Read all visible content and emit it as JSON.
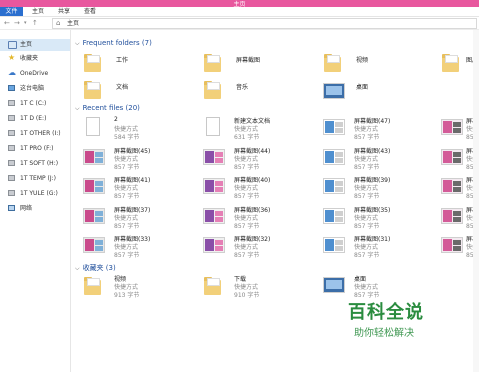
{
  "window": {
    "title": "主页"
  },
  "ribbon": {
    "file": "文件",
    "tabs": [
      "主页",
      "共享",
      "查看"
    ]
  },
  "address": {
    "path": "主页"
  },
  "sidebar": {
    "items": [
      {
        "label": "主页",
        "icon": "home-icon"
      },
      {
        "label": "收藏夹",
        "icon": "star-icon"
      },
      {
        "label": "OneDrive",
        "icon": "cloud-icon"
      },
      {
        "label": "这台电脑",
        "icon": "computer-icon"
      },
      {
        "label": "1T C (C:)",
        "icon": "drive-icon"
      },
      {
        "label": "1T D (E:)",
        "icon": "drive-icon"
      },
      {
        "label": "1T OTHER (I:)",
        "icon": "drive-icon"
      },
      {
        "label": "1T PRO (F:)",
        "icon": "drive-icon"
      },
      {
        "label": "1T SOFT (H:)",
        "icon": "drive-icon"
      },
      {
        "label": "1T TEMP (J:)",
        "icon": "drive-icon"
      },
      {
        "label": "1T YULE (G:)",
        "icon": "drive-icon"
      },
      {
        "label": "网络",
        "icon": "network-icon"
      }
    ]
  },
  "frequent": {
    "header": "Frequent folders (7)",
    "items": [
      {
        "name": "工作",
        "kind": "folder"
      },
      {
        "name": "屏幕截图",
        "kind": "folder"
      },
      {
        "name": "视频",
        "kind": "folder"
      },
      {
        "name": "图片",
        "kind": "folder"
      },
      {
        "name": "文档",
        "kind": "folder"
      },
      {
        "name": "音乐",
        "kind": "folder"
      },
      {
        "name": "桌面",
        "kind": "desktop"
      }
    ]
  },
  "recent": {
    "header": "Recent files (20)",
    "items": [
      {
        "name": "2",
        "type": "快捷方式",
        "size": "584 字节",
        "kind": "doc"
      },
      {
        "name": "新建文本文档",
        "type": "快捷方式",
        "size": "631 字节",
        "kind": "doc"
      },
      {
        "name": "屏幕截图(47)",
        "type": "快捷方式",
        "size": "857 字节",
        "kind": "shot"
      },
      {
        "name": "屏幕截图(46)",
        "type": "快捷方式",
        "size": "857 字节",
        "kind": "shot"
      },
      {
        "name": "屏幕截图(45)",
        "type": "快捷方式",
        "size": "857 字节",
        "kind": "shot"
      },
      {
        "name": "屏幕截图(44)",
        "type": "快捷方式",
        "size": "857 字节",
        "kind": "shot"
      },
      {
        "name": "屏幕截图(43)",
        "type": "快捷方式",
        "size": "857 字节",
        "kind": "shot"
      },
      {
        "name": "屏幕截图(42)",
        "type": "快捷方式",
        "size": "857 字节",
        "kind": "shot"
      },
      {
        "name": "屏幕截图(41)",
        "type": "快捷方式",
        "size": "857 字节",
        "kind": "shot"
      },
      {
        "name": "屏幕截图(40)",
        "type": "快捷方式",
        "size": "857 字节",
        "kind": "shot"
      },
      {
        "name": "屏幕截图(39)",
        "type": "快捷方式",
        "size": "857 字节",
        "kind": "shot"
      },
      {
        "name": "屏幕截图(38)",
        "type": "快捷方式",
        "size": "857 字节",
        "kind": "shot"
      },
      {
        "name": "屏幕截图(37)",
        "type": "快捷方式",
        "size": "857 字节",
        "kind": "shot"
      },
      {
        "name": "屏幕截图(36)",
        "type": "快捷方式",
        "size": "857 字节",
        "kind": "shot"
      },
      {
        "name": "屏幕截图(35)",
        "type": "快捷方式",
        "size": "857 字节",
        "kind": "shot"
      },
      {
        "name": "屏幕截图(34)",
        "type": "快捷方式",
        "size": "857 字节",
        "kind": "shot"
      },
      {
        "name": "屏幕截图(33)",
        "type": "快捷方式",
        "size": "857 字节",
        "kind": "shot"
      },
      {
        "name": "屏幕截图(32)",
        "type": "快捷方式",
        "size": "857 字节",
        "kind": "shot"
      },
      {
        "name": "屏幕截图(31)",
        "type": "快捷方式",
        "size": "857 字节",
        "kind": "shot"
      },
      {
        "name": "屏幕截图(30)",
        "type": "快捷方式",
        "size": "857 字节",
        "kind": "shot"
      }
    ]
  },
  "favorites": {
    "header": "收藏夹 (3)",
    "items": [
      {
        "name": "视频",
        "type": "快捷方式",
        "size": "913 字节",
        "kind": "folder"
      },
      {
        "name": "下载",
        "type": "快捷方式",
        "size": "910 字节",
        "kind": "folder"
      },
      {
        "name": "桌面",
        "type": "快捷方式",
        "size": "857 字节",
        "kind": "desktop"
      }
    ]
  },
  "watermark": {
    "title": "百科全说",
    "subtitle": "助你轻松解决"
  },
  "colors": {
    "titlebar": "#e8579e",
    "file_tab": "#2b6fcf",
    "section": "#1f4e9b",
    "watermark": "#2a8c3f"
  }
}
